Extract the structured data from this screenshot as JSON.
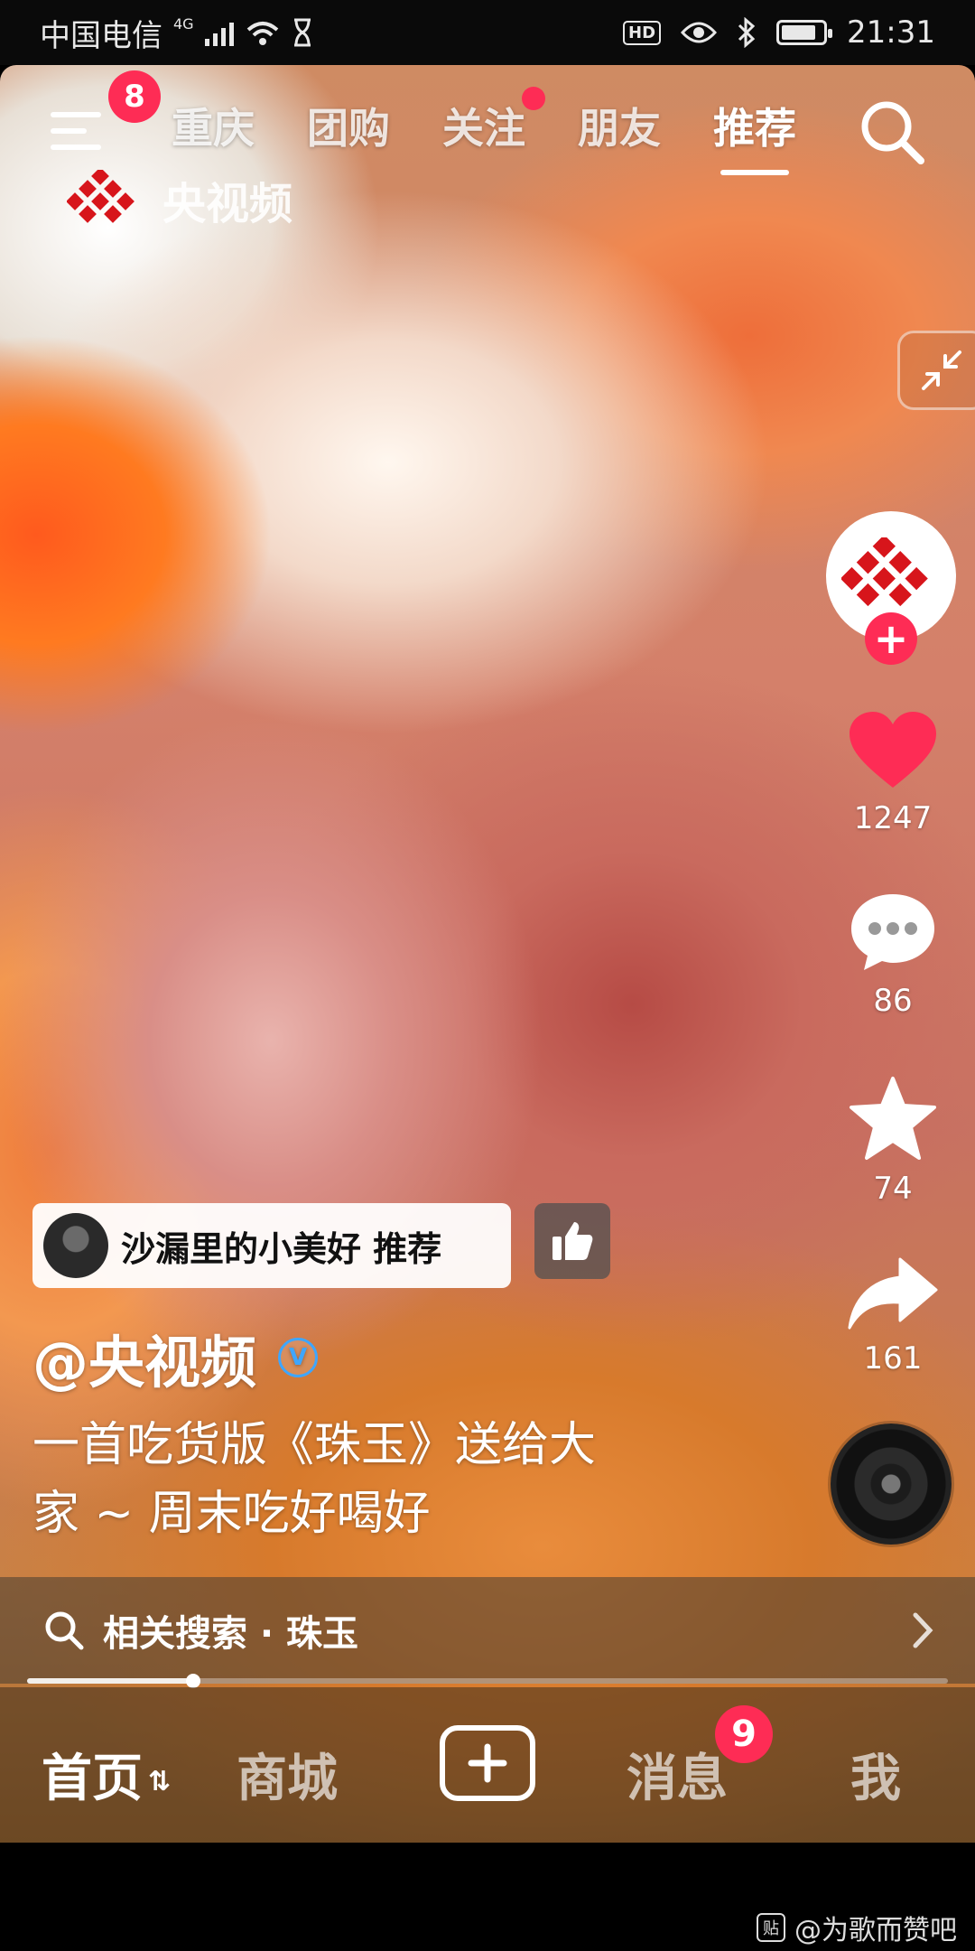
{
  "status_bar": {
    "carrier": "中国电信",
    "network": "4G",
    "time": "21:31",
    "hd_label": "HD",
    "battery_level": 0.85
  },
  "top_nav": {
    "menu_badge": "8",
    "tabs": [
      {
        "label": "重庆",
        "active": false
      },
      {
        "label": "团购",
        "active": false
      },
      {
        "label": "关注",
        "active": false,
        "has_dot": true
      },
      {
        "label": "朋友",
        "active": false
      },
      {
        "label": "推荐",
        "active": true
      }
    ],
    "search_icon": "search-icon"
  },
  "channel_logo": {
    "text": "央视频"
  },
  "actions": {
    "likes": "1247",
    "comments": "86",
    "favorites": "74",
    "shares": "161"
  },
  "recommend_chip": {
    "text": "沙漏里的小美好 推荐"
  },
  "video_info": {
    "author": "@央视频",
    "caption_line1": "一首吃货版《珠玉》送给大",
    "caption_line2": "家 ~ 周末吃好喝好"
  },
  "related_search": {
    "label": "相关搜索 · 珠玉"
  },
  "progress": {
    "fraction": 0.18
  },
  "bottom_tabs": {
    "home": "首页",
    "mall": "商城",
    "messages": "消息",
    "messages_badge": "9",
    "me": "我"
  },
  "watermark": {
    "icon_text": "贴",
    "text": "@为歌而赞吧"
  },
  "colors": {
    "accent": "#fe2c55",
    "verified": "#3ea6ff"
  }
}
